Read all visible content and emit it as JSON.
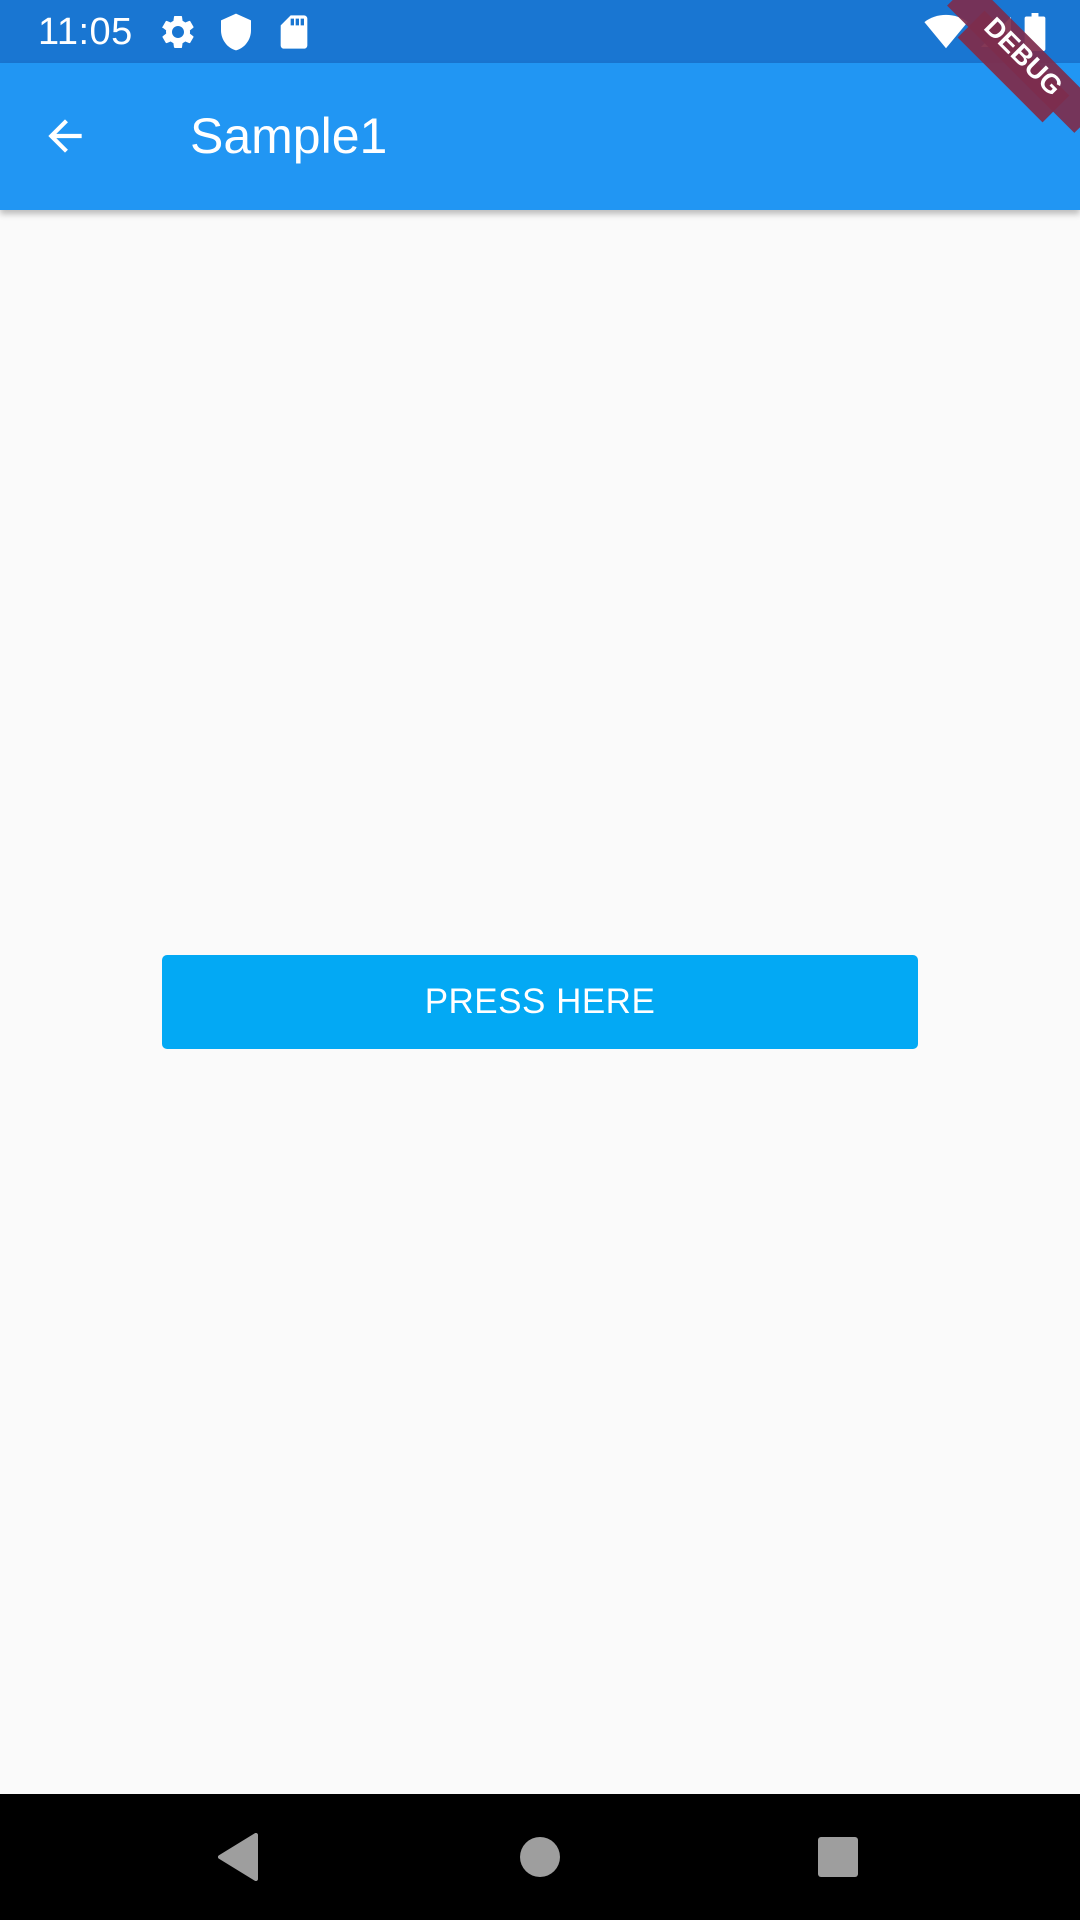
{
  "status_bar": {
    "time": "11:05",
    "background": "#1976d2",
    "icons_left": [
      "settings-icon",
      "shield-icon",
      "sd-card-icon"
    ],
    "icons_right": [
      "wifi-icon",
      "cell-signal-icon",
      "battery-icon"
    ]
  },
  "app_bar": {
    "title": "Sample1",
    "background": "#2196f3",
    "back_icon": "arrow-back-icon"
  },
  "debug_banner": {
    "label": "DEBUG",
    "color": "#7d2d4d"
  },
  "main": {
    "button_label": "PRESS HERE",
    "button_color": "#03a9f4",
    "background": "#fafafa"
  },
  "nav_bar": {
    "background": "#000000",
    "buttons": [
      "back-triangle-icon",
      "home-circle-icon",
      "recents-square-icon"
    ]
  }
}
